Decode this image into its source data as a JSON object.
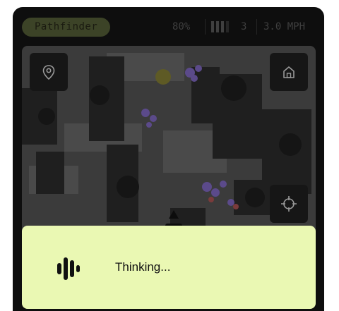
{
  "header": {
    "app_title": "Pathfinder",
    "battery": "80%",
    "signal_bars": 3,
    "count": "3",
    "speed": "3.0 MPH"
  },
  "map": {
    "pin_icon": "map-pin-icon",
    "home_icon": "home-icon",
    "target_icon": "crosshair-icon",
    "robot_icon": "robot-position-icon"
  },
  "panel": {
    "icon": "voice-waveform-icon",
    "status_text": "Thinking..."
  },
  "colors": {
    "device_bg": "#0e0e0e",
    "pill_bg": "#3c4327",
    "panel_bg": "#eaf8b3",
    "map_bg": "#3b3b3b",
    "obstacle": "#1f1f1f",
    "marker_purple": "#5b4a8a",
    "marker_red": "#7a3b3b",
    "marker_yellow": "#5e5a25"
  }
}
